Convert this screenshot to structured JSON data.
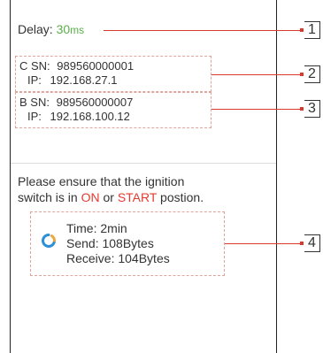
{
  "delay": {
    "label": "Delay:",
    "value": "30",
    "unit": "ms"
  },
  "connections": [
    {
      "sn_label": "C SN:",
      "sn": "989560000001",
      "ip_label": "IP:",
      "ip": "192.168.27.1"
    },
    {
      "sn_label": "B SN:",
      "sn": "989560000007",
      "ip_label": "IP:",
      "ip": "192.168.100.12"
    }
  ],
  "notice": {
    "line1": "Please ensure that the ignition",
    "line2_prefix": "switch is in ",
    "on": "ON",
    "or": " or ",
    "start": "START",
    "line2_suffix": " postion."
  },
  "stats": {
    "time": "Time: 2min",
    "send": "Send: 108Bytes",
    "receive": "Receive: 104Bytes"
  },
  "callouts": [
    "1",
    "2",
    "3",
    "4"
  ],
  "colors": {
    "green": "#5bb04a",
    "red": "#e23b2f",
    "callout": "#d93a2b",
    "loader": "#2d8fd6"
  },
  "icons": {
    "loader": "loading-spinner-icon"
  }
}
